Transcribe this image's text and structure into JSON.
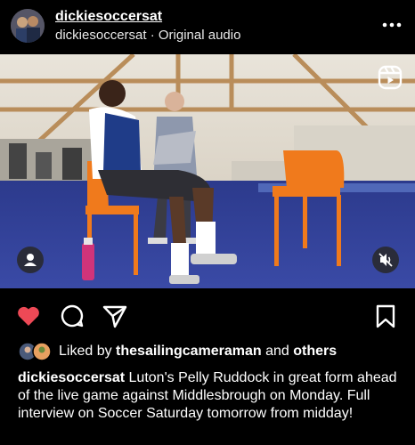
{
  "header": {
    "username": "dickiesoccersat",
    "subtitle_user": "dickiesoccersat",
    "subtitle_separator": "·",
    "subtitle_audio": "Original audio"
  },
  "media": {
    "type": "reel-video",
    "icons": [
      "reels-icon",
      "user-tag-icon",
      "muted-speaker-icon"
    ]
  },
  "actions": {
    "icons": [
      "heart-icon",
      "comment-icon",
      "share-icon",
      "bookmark-icon"
    ],
    "heart_color": "#ed4956",
    "liked": true
  },
  "likes": {
    "prefix": "Liked by",
    "user": "thesailingcameraman",
    "connector": "and",
    "others": "others"
  },
  "caption": {
    "username": "dickiesoccersat",
    "text": "Luton's Pelly Ruddock in great form ahead of the live game against Middlesbrough on Monday. Full interview on Soccer Saturday tomorrow from midday!"
  }
}
